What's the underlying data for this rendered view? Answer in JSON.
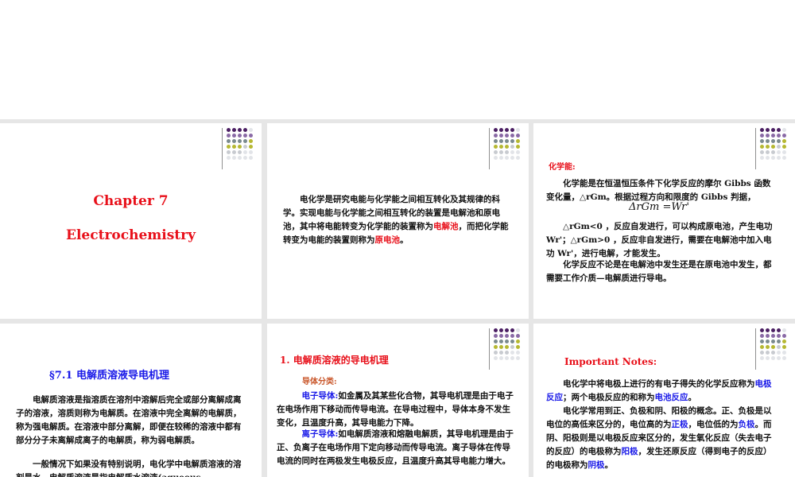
{
  "slide1": {
    "title": "Chapter 7",
    "subtitle": "Electrochemistry"
  },
  "slide2": {
    "p_a": "电化学是研究电能与化学能之间相互转化及其规律的科学。实现电能与化学能之间相互转化的装置是电解池和原电池，其中将电能转变为化学能的装置称为",
    "hl1": "电解池",
    "p_b": "，而把化学能转变为电能的装置则称为",
    "hl2": "原电池",
    "p_c": "。"
  },
  "slide3": {
    "label": "化学能:",
    "para1": "化学能是在恒温恒压条件下化学反应的摩尔 Gibbs 函数变化量，△rGm。根据过程方向和限度的 Gibbs 判据，",
    "formula_lhs": "ΔrGm",
    "formula_eq": "=",
    "formula_rhs": "Wr'",
    "para2_a": "△rGm<0 ，反应自发进行，可以构成原电池，产生电功 Wr'；",
    "para2_b": "△rGm>0 ，反应非自发进行，需要在电解池中加入电功 Wr'，进行电解，才能发生。",
    "para3": "化学反应不论是在电解池中发生还是在原电池中发生，都需要工作介质—电解质进行导电。"
  },
  "slide4": {
    "heading": "§7.1  电解质溶液导电机理",
    "p1": "电解质溶液是指溶质在溶剂中溶解后完全或部分离解成离子的溶液，溶质则称为电解质。在溶液中完全离解的电解质，称为强电解质。在溶液中部分离解，即便在较稀的溶液中都有部分分子未离解成离子的电解质，称为弱电解质。",
    "p2": "一般情况下如果没有特别说明，电化学中电解质溶液的溶剂是水，电解质溶液是指电解质水溶液(aqueous electrolyte solution)。"
  },
  "slide5": {
    "heading": "1.  电解质溶液的导电机理",
    "subheading": "导体分类:",
    "term1": "电子导体:",
    "p1": "如金属及其某些化合物，其导电机理是由于电子在电场作用下移动而传导电流。在导电过程中，导体本身不发生变化，且温度升高，其导电能力下降。",
    "term2": "离子导体:",
    "p2": "如电解质溶液和熔融电解质，其导电机理是由于正、负离子在电场作用下定向移动而传导电流。离子导体在传导电流的同时在两极发生电极反应，且温度升高其导电能力增大。"
  },
  "slide6": {
    "heading": "Important Notes:",
    "p1_a": "电化学中将电极上进行的有电子得失的化学反应称为",
    "p1_hl1": "电极反应",
    "p1_b": "；两个电极反应的和称为",
    "p1_hl2": "电池反应",
    "p1_c": "。",
    "p2_a": "电化学常用到正、负极和阴、阳极的概念。正、负极是以电位的高低来区分的，电位高的为",
    "p2_hl1": "正极",
    "p2_b": "，电位低的为",
    "p2_hl2": "负极",
    "p2_c": "。而阴、阳极则是以电极反应来区分的，发生氧化反应（失去电子的反应）的电极称为",
    "p2_hl3": "阳极",
    "p2_d": "，发生还原反应（得到电子的反应）的电极称为",
    "p2_hl4": "阴极",
    "p2_e": "。"
  }
}
